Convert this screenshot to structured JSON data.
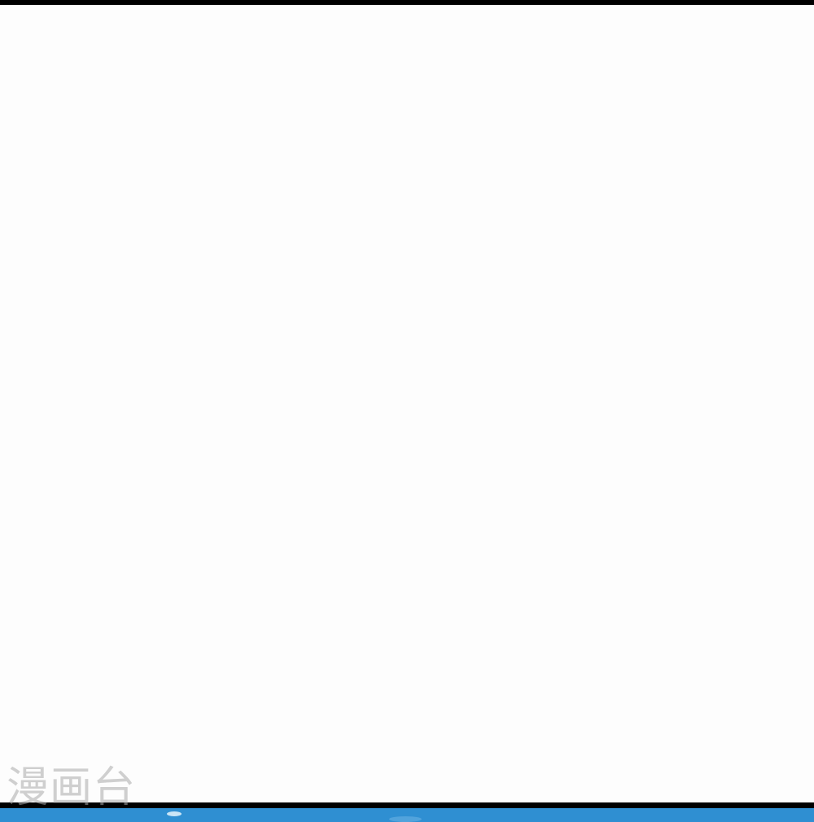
{
  "watermark": {
    "text": "漫画台"
  },
  "colors": {
    "frame_border": "#000000",
    "panel_background": "#fdfdfd",
    "next_panel_blue": "#2f8fd2",
    "watermark_gray": "#aaaaaa"
  }
}
